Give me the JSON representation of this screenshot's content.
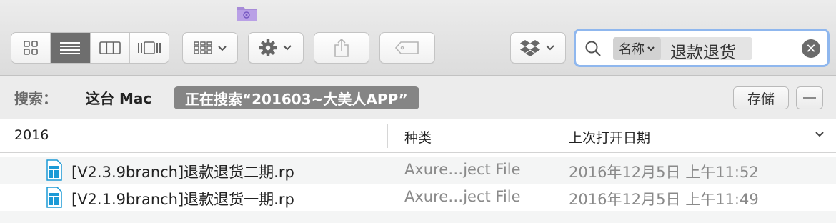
{
  "toolbar": {
    "view_buttons": [
      "icon-view",
      "list-view",
      "column-view",
      "cover-flow-view"
    ],
    "active_view": "list-view"
  },
  "search": {
    "token_key": "名称",
    "token_value": "退款退货"
  },
  "scope": {
    "label": "搜索：",
    "location": "这台 Mac",
    "query": "正在搜索“201603~大美人APP”",
    "save_label": "存储"
  },
  "columns": {
    "name": "2016",
    "kind": "种类",
    "date": "上次打开日期"
  },
  "files": [
    {
      "name": "[V2.3.9branch]退款退货二期.rp",
      "kind": "Axure…ject File",
      "date": "2016年12月5日 上午11:52"
    },
    {
      "name": "[V2.1.9branch]退款退货一期.rp",
      "kind": "Axure…ject File",
      "date": "2016年12月5日 上午11:49"
    }
  ],
  "colors": {
    "toolbar_bg": "#e6e6e6",
    "search_focus": "#8fb7ee",
    "scope_token": "#858585",
    "row_alt": "#f4f5f5",
    "file_icon": "#1b9ad6",
    "folder": "#a78bd8"
  }
}
